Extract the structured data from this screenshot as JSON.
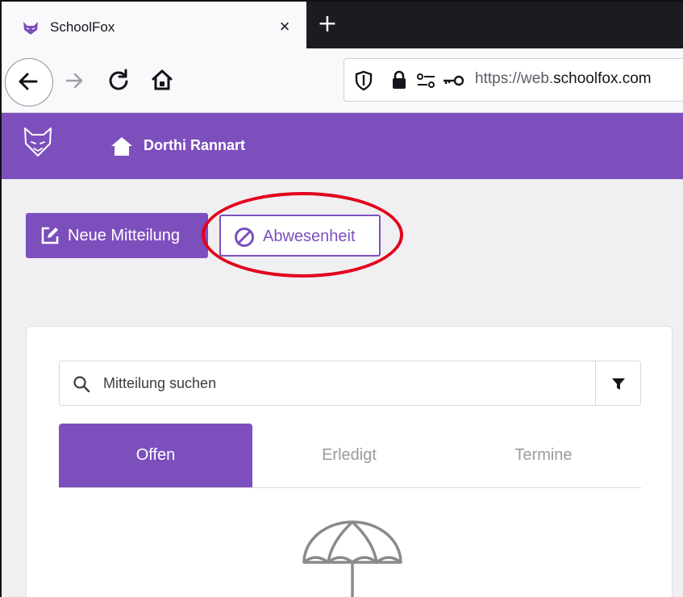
{
  "browser": {
    "tab_title": "SchoolFox",
    "tab_close": "×",
    "new_tab": "+",
    "url_prefix": "https://web.",
    "url_domain": "schoolfox.com"
  },
  "app": {
    "user_name": "Dorthi Rannart",
    "brand_color": "#7d4fbd"
  },
  "actions": {
    "new_message_label": "Neue Mitteilung",
    "absence_label": "Abwesenheit"
  },
  "search": {
    "placeholder": "Mitteilung suchen"
  },
  "tabs": [
    {
      "label": "Offen",
      "active": true
    },
    {
      "label": "Erledigt",
      "active": false
    },
    {
      "label": "Termine",
      "active": false
    }
  ],
  "icons": {
    "fox_logo": "fox-logo-icon",
    "home": "home-icon",
    "edit": "edit-icon",
    "no_entry": "no-entry-icon",
    "search": "search-icon",
    "filter": "filter-icon",
    "umbrella": "umbrella-icon"
  },
  "highlight_color": "#e3001b"
}
